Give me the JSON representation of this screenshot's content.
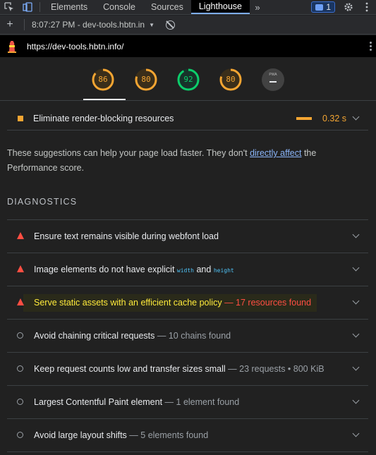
{
  "devtools": {
    "tabs": [
      {
        "label": "Elements"
      },
      {
        "label": "Console"
      },
      {
        "label": "Sources"
      },
      {
        "label": "Lighthouse"
      }
    ],
    "active_tab": "Lighthouse",
    "issues_count": "1"
  },
  "toolbar": {
    "report_label": "8:07:27 PM - dev-tools.hbtn.in"
  },
  "url": "https://dev-tools.hbtn.info/",
  "gauges": [
    {
      "score": "86",
      "value": 0.86,
      "color": "#f4a532"
    },
    {
      "score": "80",
      "value": 0.8,
      "color": "#f4a532"
    },
    {
      "score": "92",
      "value": 0.92,
      "color": "#0cce6b"
    },
    {
      "score": "80",
      "value": 0.8,
      "color": "#f4a532"
    }
  ],
  "pwa_label": "PWA",
  "opportunity": {
    "title": "Eliminate render-blocking resources",
    "value": "0.32 s"
  },
  "suggestion": {
    "before": "These suggestions can help your page load faster. They don't ",
    "link": "directly affect",
    "after": " the Performance score."
  },
  "diagnostics_heading": "DIAGNOSTICS",
  "audits": [
    {
      "text": "Ensure text remains visible during webfont load",
      "detail": ""
    },
    {
      "text_before": "Image elements do not have explicit ",
      "code1": "width",
      "mid": " and ",
      "code2": "height"
    },
    {
      "text": "Serve static assets with an efficient cache policy",
      "detail": "17 resources found"
    },
    {
      "text": "Avoid chaining critical requests",
      "detail": "10 chains found"
    },
    {
      "text": "Keep request counts low and transfer sizes small",
      "detail": "23 requests • 800 KiB"
    },
    {
      "text": "Largest Contentful Paint element",
      "detail": "1 element found"
    },
    {
      "text": "Avoid large layout shifts",
      "detail": "5 elements found"
    }
  ],
  "colors": {
    "average": "#f4a532",
    "pass": "#0cce6b",
    "fail": "#ff4e42",
    "highlight_text": "#ffeb3b"
  }
}
